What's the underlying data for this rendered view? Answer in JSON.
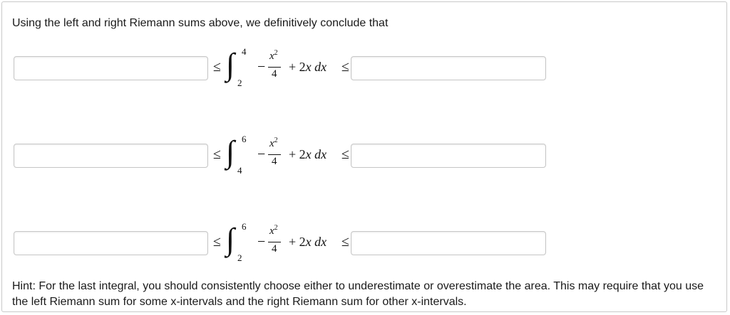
{
  "intro_text": "Using the left and right Riemann sums above, we definitively conclude that",
  "rows": [
    {
      "left_input_value": "",
      "right_input_value": "",
      "lower_limit": "2",
      "upper_limit": "4",
      "leq_symbol": "≤",
      "integral_symbol": "∫",
      "negation": "−",
      "numerator_var": "x",
      "numerator_power": "2",
      "denominator": "4",
      "rest_plus": "+ 2",
      "rest_x": "x",
      "rest_dx": "dx"
    },
    {
      "left_input_value": "",
      "right_input_value": "",
      "lower_limit": "4",
      "upper_limit": "6",
      "leq_symbol": "≤",
      "integral_symbol": "∫",
      "negation": "−",
      "numerator_var": "x",
      "numerator_power": "2",
      "denominator": "4",
      "rest_plus": "+ 2",
      "rest_x": "x",
      "rest_dx": "dx"
    },
    {
      "left_input_value": "",
      "right_input_value": "",
      "lower_limit": "2",
      "upper_limit": "6",
      "leq_symbol": "≤",
      "integral_symbol": "∫",
      "negation": "−",
      "numerator_var": "x",
      "numerator_power": "2",
      "denominator": "4",
      "rest_plus": "+ 2",
      "rest_x": "x",
      "rest_dx": "dx"
    }
  ],
  "hint_text": "Hint: For the last integral, you should consistently choose either to underestimate or overestimate the area. This may require that you use the left Riemann sum for some x-intervals and the right Riemann sum for other x-intervals."
}
